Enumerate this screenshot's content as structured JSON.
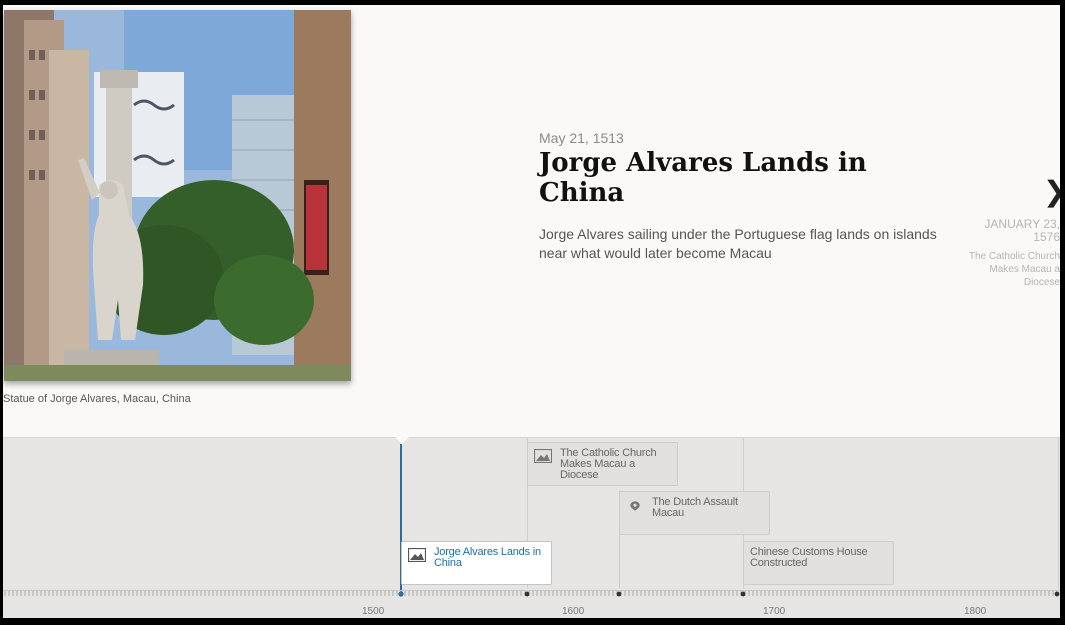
{
  "slide": {
    "date": "May 21, 1513",
    "title": "Jorge Alvares Lands in China",
    "text": "Jorge Alvares sailing under the Portuguese flag lands on islands near what would later become Macau",
    "caption": "Statue of Jorge Alvares, Macau, China"
  },
  "next_slide": {
    "date": "January 23, 1576",
    "title": "The Catholic Church Makes Macau a Diocese"
  },
  "navigation": {
    "next_arrow": "❯",
    "markers": [
      {
        "title": "The Catholic Church Makes Macau a Diocese",
        "icon": "image-icon"
      },
      {
        "title": "The Dutch Assault Macau",
        "icon": "map-pin-icon"
      },
      {
        "title": "Jorge Alvares Lands in China",
        "icon": "image-icon",
        "active": true
      },
      {
        "title": "Chinese Customs House Constructed",
        "icon": "none"
      }
    ],
    "axis_labels": [
      "1500",
      "1600",
      "1700",
      "1800"
    ]
  },
  "colors": {
    "accent": "#1e6fa3",
    "timeline_background": "#e7e5e3",
    "slide_background": "#faf9f8"
  }
}
